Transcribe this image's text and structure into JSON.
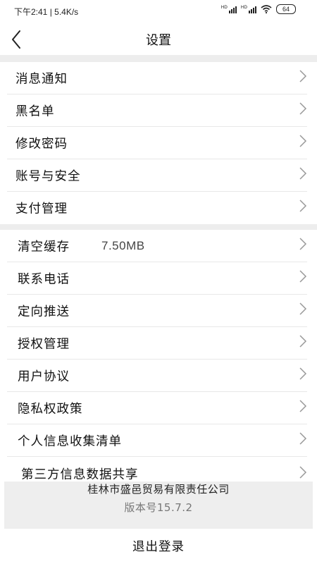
{
  "status_bar": {
    "time": "下午2:41",
    "network_speed": "5.4K/s",
    "signal_1_label": "HD",
    "signal_2_label": "HD",
    "battery": "64",
    "icons": [
      "signal-hd-icon",
      "signal-hd-icon",
      "wifi-icon",
      "battery-icon"
    ]
  },
  "nav": {
    "back_icon": "back-arrow-icon",
    "title": "设置"
  },
  "section1": [
    {
      "label": "消息通知",
      "icon": "chevron-right-icon"
    },
    {
      "label": "黑名单",
      "icon": "chevron-right-icon"
    },
    {
      "label": "修改密码",
      "icon": "chevron-right-icon"
    },
    {
      "label": "账号与安全",
      "icon": "chevron-right-icon"
    },
    {
      "label": "支付管理",
      "icon": "chevron-right-icon"
    }
  ],
  "section2": [
    {
      "label": "清空缓存",
      "value": "7.50MB",
      "icon": "chevron-right-icon"
    },
    {
      "label": "联系电话",
      "icon": "chevron-right-icon"
    },
    {
      "label": "定向推送",
      "icon": "chevron-right-icon"
    },
    {
      "label": "授权管理",
      "icon": "chevron-right-icon"
    },
    {
      "label": "用户协议",
      "icon": "chevron-right-icon"
    },
    {
      "label": "隐私权政策",
      "icon": "chevron-right-icon"
    },
    {
      "label": "个人信息收集清单",
      "icon": "chevron-right-icon"
    },
    {
      "label": "第三方信息数据共享",
      "icon": "chevron-right-icon"
    }
  ],
  "footer": {
    "company": "桂林市盛邑贸易有限责任公司",
    "version": "版本号15.7.2"
  },
  "logout_label": "退出登录",
  "colors": {
    "background": "#ffffff",
    "separator": "#ededed",
    "footer_bg": "#eeeeee",
    "text": "#111111",
    "muted_text": "#777777",
    "chevron": "#999999"
  }
}
